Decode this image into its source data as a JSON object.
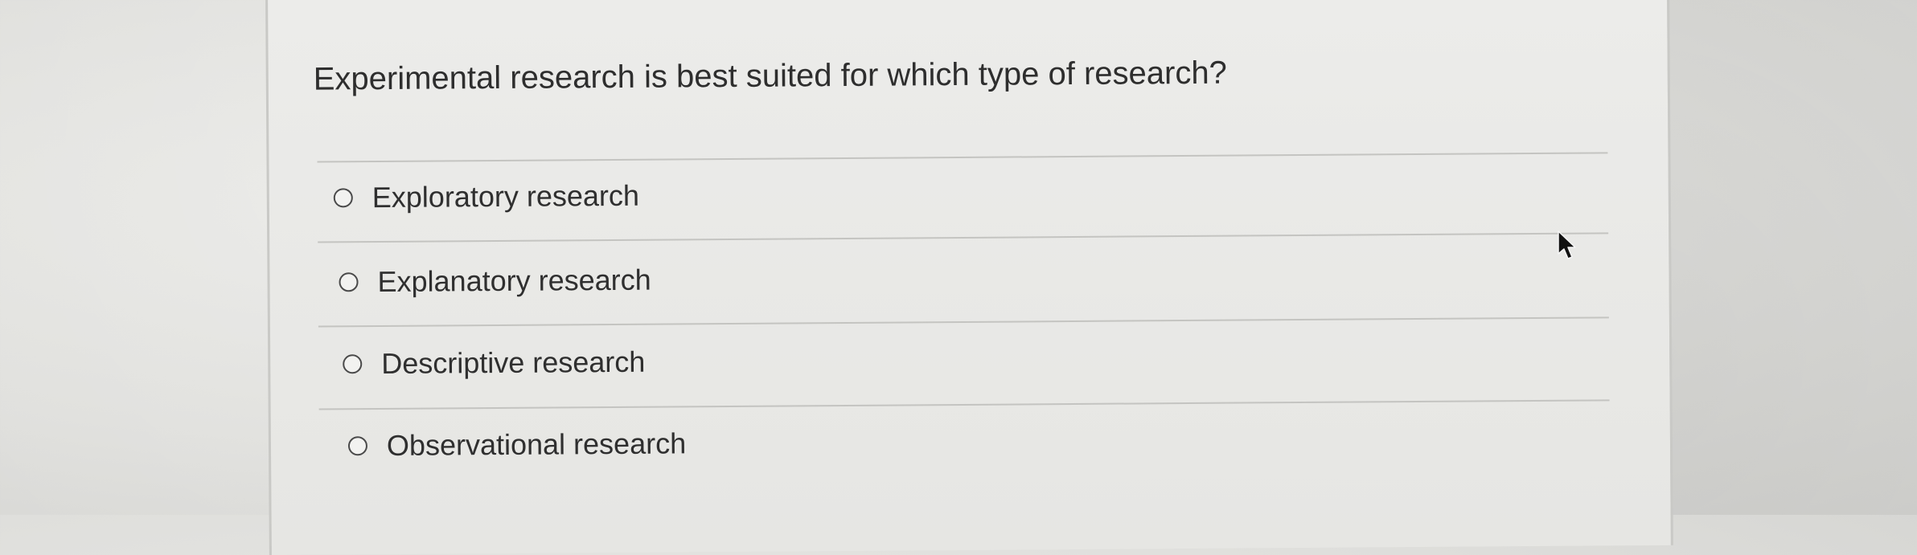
{
  "quiz": {
    "question": "Experimental research is best suited for which type of research?",
    "options": [
      {
        "label": "Exploratory research",
        "selected": false
      },
      {
        "label": "Explanatory research",
        "selected": false
      },
      {
        "label": "Descriptive research",
        "selected": false
      },
      {
        "label": "Observational research",
        "selected": false
      }
    ]
  },
  "icons": {
    "radio": "radio-unselected-icon",
    "cursor": "mouse-pointer-icon"
  }
}
